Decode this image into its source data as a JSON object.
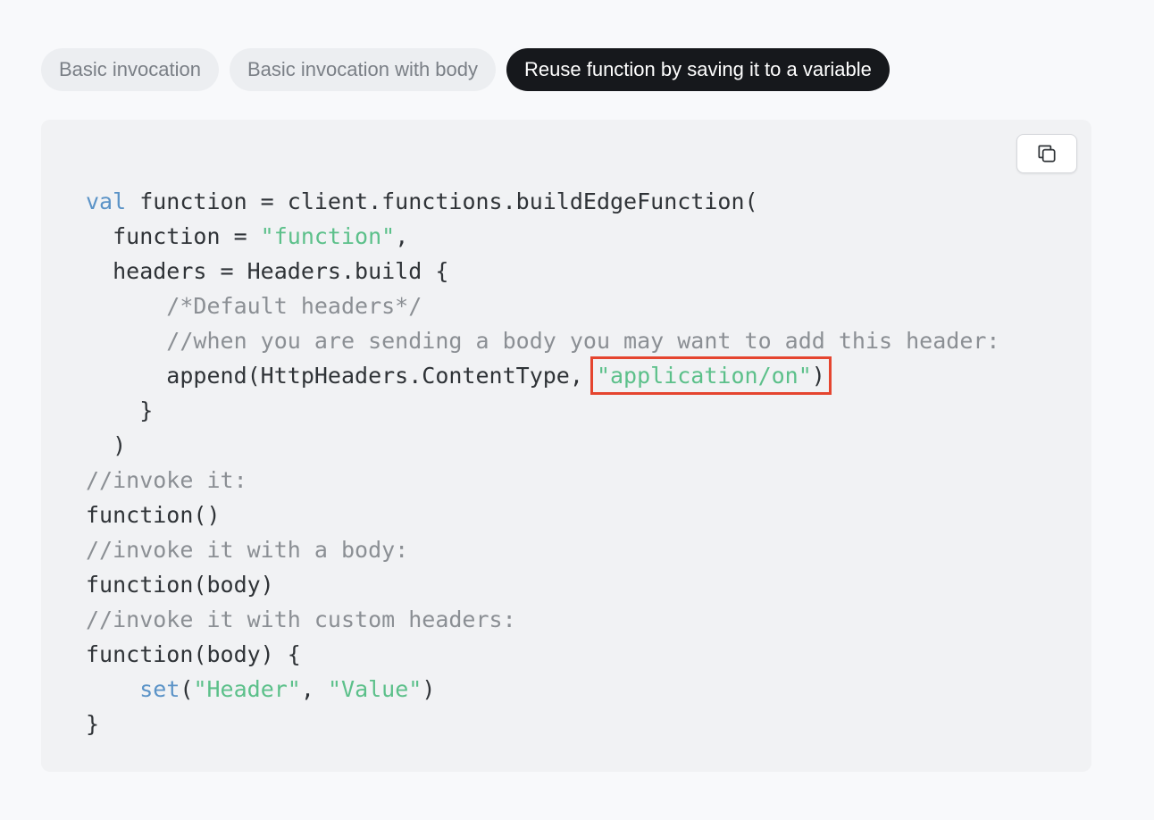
{
  "tabs": [
    {
      "label": "Basic invocation",
      "active": false
    },
    {
      "label": "Basic invocation with body",
      "active": false
    },
    {
      "label": "Reuse function by saving it to a variable",
      "active": true
    }
  ],
  "copy_button": {
    "icon": "copy-icon"
  },
  "code": {
    "l1_kw": "val",
    "l1_rest": " function = client.functions.buildEdgeFunction(",
    "l2_pre": "  function = ",
    "l2_str": "\"function\"",
    "l2_post": ",",
    "l3": "  headers = Headers.build {",
    "l4_cm": "      /*Default headers*/",
    "l5_cm": "      //when you are sending a body you may want to add this header:",
    "l6_pre": "      append(HttpHeaders.ContentType, ",
    "l6_str": "\"application/on\"",
    "l6_post": ")",
    "l7": "    }",
    "l8": "  )",
    "l9_cm": "//invoke it:",
    "l10": "function()",
    "l11_cm": "//invoke it with a body:",
    "l12": "function(body)",
    "l13_cm": "//invoke it with custom headers:",
    "l14": "function(body) {",
    "l15_indent": "    ",
    "l15_kw": "set",
    "l15_p1": "(",
    "l15_s1": "\"Header\"",
    "l15_p2": ", ",
    "l15_s2": "\"Value\"",
    "l15_p3": ")",
    "l16": "}"
  },
  "colors": {
    "keyword": "#5b93c7",
    "string": "#5cc08a",
    "comment": "#8b8f94",
    "highlight_box": "#e5452f",
    "active_tab_bg": "#16181c"
  }
}
